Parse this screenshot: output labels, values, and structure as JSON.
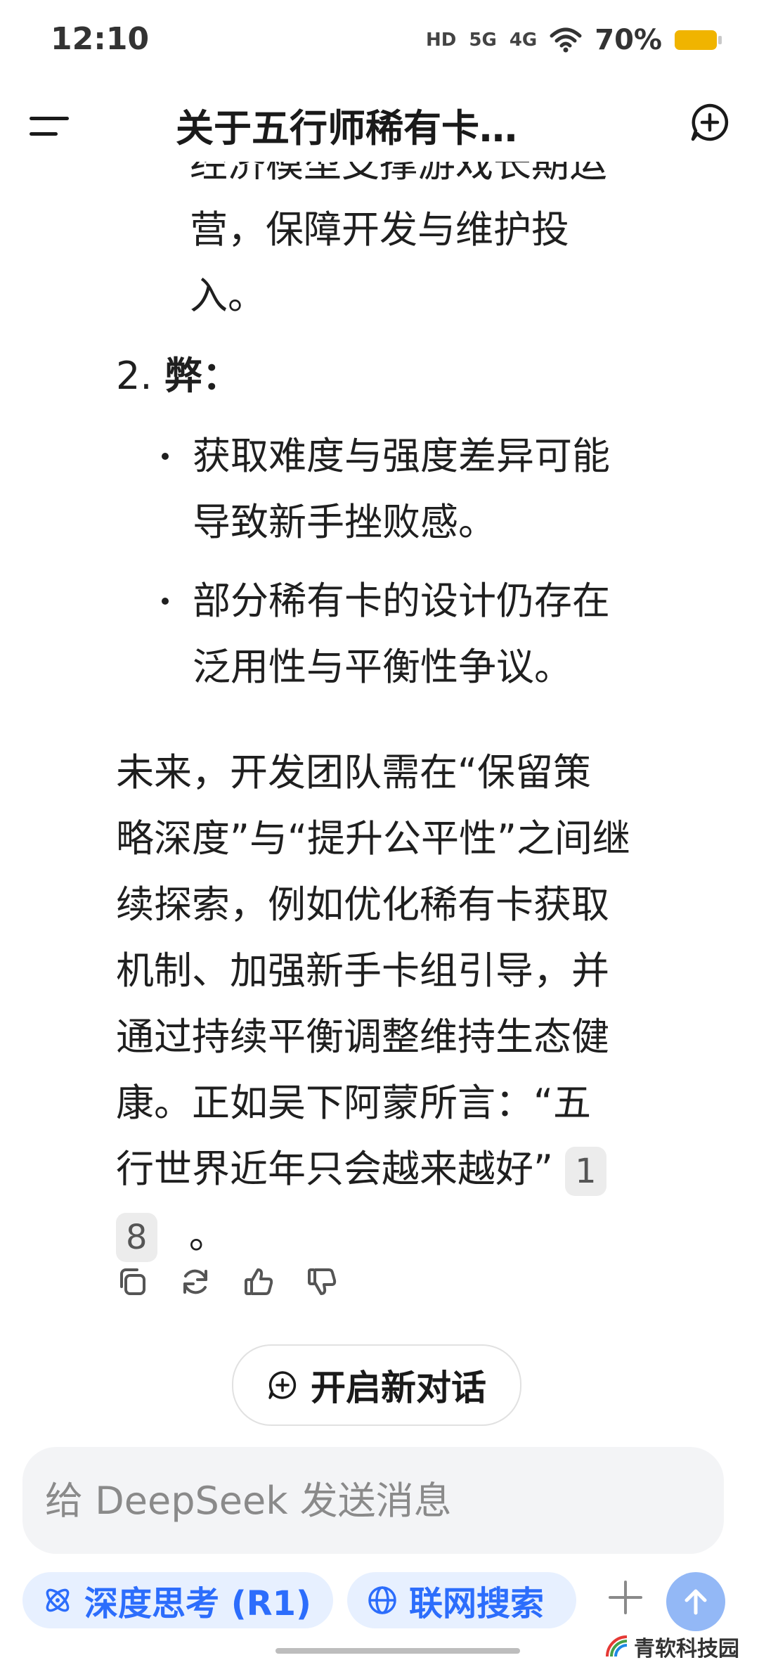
{
  "status_bar": {
    "time": "12:10",
    "signal_1": "HD",
    "signal_2": "5G",
    "signal_3": "4G",
    "battery": "70%"
  },
  "header": {
    "title": "关于五行师稀有卡…"
  },
  "content": {
    "continuation_line_1": "经济模型支撑游戏长期运",
    "continuation_line_2": "营，保障开发与维护投",
    "continuation_line_3": "入。",
    "section_2_number": "2.",
    "section_2_title": "弊：",
    "bullets": [
      {
        "line_1": "获取难度与强度差异可能",
        "line_2": "导致新手挫败感。"
      },
      {
        "line_1": "部分稀有卡的设计仍存在",
        "line_2": "泛用性与平衡性争议。"
      }
    ],
    "paragraph_lines": [
      "未来，开发团队需在“保留策",
      "略深度”与“提升公平性”之间继",
      "续探索，例如优化稀有卡获取",
      "机制、加强新手卡组引导，并",
      "通过持续平衡调整维持生态健",
      "康。正如吴下阿蒙所言：“五",
      "行世界近年只会越来越好”"
    ],
    "citation_1": "1",
    "citation_2": "8",
    "paragraph_end": "。"
  },
  "actions": {
    "copy": "copy-icon",
    "regenerate": "refresh-icon",
    "like": "thumbs-up-icon",
    "dislike": "thumbs-down-icon"
  },
  "new_conversation": {
    "label": "开启新对话"
  },
  "input": {
    "placeholder": "给 DeepSeek 发送消息",
    "value": ""
  },
  "chips": {
    "deep_think": "深度思考 (R1)",
    "web_search": "联网搜索"
  },
  "watermark": "青软科技园",
  "colors": {
    "accent": "#2c6dfc",
    "chip_bg": "#e7f0ff",
    "send_bg": "#93b8f6",
    "battery": "#f0b400"
  }
}
